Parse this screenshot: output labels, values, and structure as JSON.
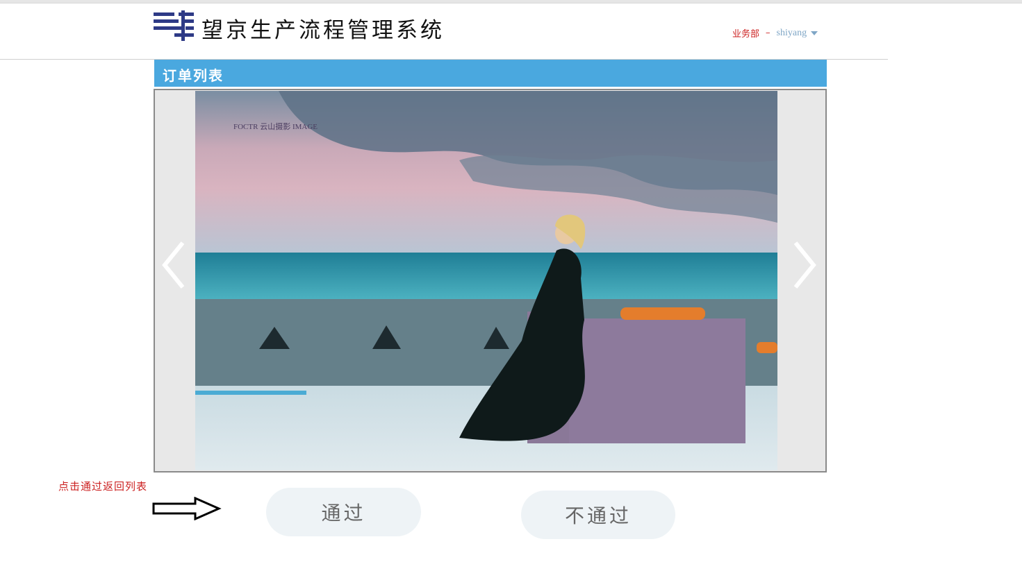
{
  "header": {
    "app_title": "望京生产流程管理系统",
    "department": "业务部",
    "separator": "–",
    "username": "shiyang"
  },
  "section": {
    "title": "订单列表"
  },
  "carousel": {
    "photo_watermark": "FOCTR 云山摄影 IMAGE"
  },
  "hint": {
    "text": "点击通过返回列表"
  },
  "actions": {
    "pass_label": "通过",
    "reject_label": "不通过"
  },
  "colors": {
    "accent": "#4aa8df",
    "hint_text": "#cc2222",
    "username": "#7fa6c6",
    "logo": "#2e3a86"
  }
}
